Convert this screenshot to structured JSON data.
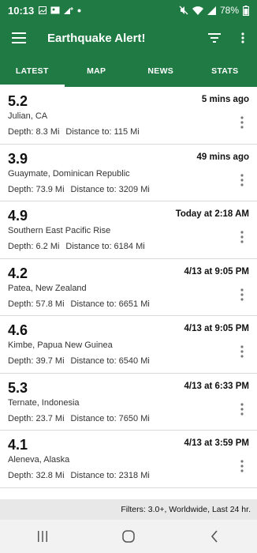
{
  "status": {
    "time": "10:13",
    "battery": "78%"
  },
  "app": {
    "title": "Earthquake Alert!"
  },
  "tabs": [
    {
      "label": "LATEST",
      "active": true
    },
    {
      "label": "MAP"
    },
    {
      "label": "NEWS"
    },
    {
      "label": "STATS"
    }
  ],
  "quakes": [
    {
      "magnitude": "5.2",
      "time": "5 mins ago",
      "place": "Julian, CA",
      "depth": "Depth: 8.3 Mi",
      "distance": "Distance to: 115 Mi"
    },
    {
      "magnitude": "3.9",
      "time": "49 mins ago",
      "place": "Guaymate, Dominican Republic",
      "depth": "Depth: 73.9 Mi",
      "distance": "Distance to: 3209 Mi"
    },
    {
      "magnitude": "4.9",
      "time": "Today at 2:18 AM",
      "place": "Southern East Pacific Rise",
      "depth": "Depth: 6.2 Mi",
      "distance": "Distance to: 6184 Mi"
    },
    {
      "magnitude": "4.2",
      "time": "4/13 at 9:05 PM",
      "place": "Patea, New Zealand",
      "depth": "Depth: 57.8 Mi",
      "distance": "Distance to: 6651 Mi"
    },
    {
      "magnitude": "4.6",
      "time": "4/13 at 9:05 PM",
      "place": "Kimbe, Papua New Guinea",
      "depth": "Depth: 39.7 Mi",
      "distance": "Distance to: 6540 Mi"
    },
    {
      "magnitude": "5.3",
      "time": "4/13 at 6:33 PM",
      "place": "Ternate, Indonesia",
      "depth": "Depth: 23.7 Mi",
      "distance": "Distance to: 7650 Mi"
    },
    {
      "magnitude": "4.1",
      "time": "4/13 at 3:59 PM",
      "place": "Aleneva, Alaska",
      "depth": "Depth: 32.8 Mi",
      "distance": "Distance to: 2318 Mi"
    }
  ],
  "filter_text": "Filters: 3.0+, Worldwide, Last 24 hr.",
  "icons": {
    "menu": "hamburger-menu-icon",
    "filter": "filter-icon",
    "overflow": "vertical-dots-icon",
    "nav_recents": "recents-icon",
    "nav_home": "home-icon",
    "nav_back": "back-icon"
  },
  "colors": {
    "app_bar": "#1f7a43",
    "tab_indicator": "#ffffff"
  }
}
